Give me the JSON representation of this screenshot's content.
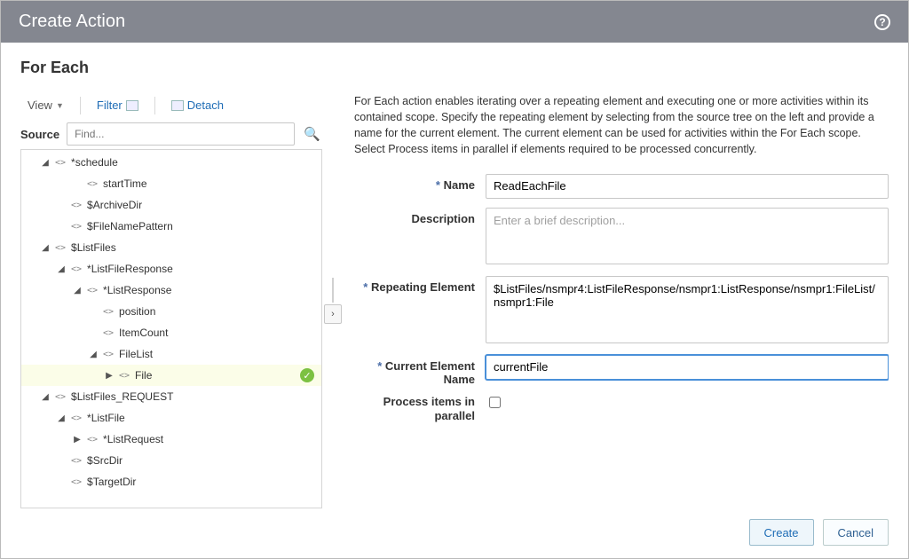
{
  "header": {
    "title": "Create Action"
  },
  "section_title": "For Each",
  "toolbar": {
    "view_label": "View",
    "filter_label": "Filter",
    "detach_label": "Detach"
  },
  "source": {
    "label": "Source",
    "find_placeholder": "Find..."
  },
  "tree": [
    {
      "indent": 0,
      "toggle": "▲",
      "kind": "tag",
      "star": true,
      "label": "schedule"
    },
    {
      "indent": 2,
      "toggle": "",
      "kind": "tag",
      "star": false,
      "label": "startTime"
    },
    {
      "indent": 1,
      "toggle": "",
      "kind": "var",
      "star": false,
      "label": "ArchiveDir"
    },
    {
      "indent": 1,
      "toggle": "",
      "kind": "var",
      "star": false,
      "label": "FileNamePattern"
    },
    {
      "indent": 0,
      "toggle": "▲",
      "kind": "var",
      "star": false,
      "label": "ListFiles"
    },
    {
      "indent": 1,
      "toggle": "▲",
      "kind": "tag",
      "star": true,
      "label": "ListFileResponse"
    },
    {
      "indent": 2,
      "toggle": "▲",
      "kind": "tag",
      "star": true,
      "label": "ListResponse"
    },
    {
      "indent": 3,
      "toggle": "",
      "kind": "tag",
      "star": false,
      "label": "position"
    },
    {
      "indent": 3,
      "toggle": "",
      "kind": "tag",
      "star": false,
      "label": "ItemCount"
    },
    {
      "indent": 3,
      "toggle": "▲",
      "kind": "tag",
      "star": false,
      "label": "FileList"
    },
    {
      "indent": 4,
      "toggle": "▶",
      "kind": "tag",
      "star": false,
      "label": "File",
      "selected": true,
      "check": true
    },
    {
      "indent": 0,
      "toggle": "▲",
      "kind": "var",
      "star": false,
      "label": "ListFiles_REQUEST"
    },
    {
      "indent": 1,
      "toggle": "▲",
      "kind": "tag",
      "star": true,
      "label": "ListFile"
    },
    {
      "indent": 2,
      "toggle": "▶",
      "kind": "tag",
      "star": true,
      "label": "ListRequest"
    },
    {
      "indent": 1,
      "toggle": "",
      "kind": "var",
      "star": false,
      "label": "SrcDir"
    },
    {
      "indent": 1,
      "toggle": "",
      "kind": "var",
      "star": false,
      "label": "TargetDir"
    }
  ],
  "description_text": "For Each action enables iterating over a repeating element and executing one or more activities within its contained scope. Specify the repeating element by selecting from the source tree on the left and provide a name for the current element. The current element can be used for activities within the For Each scope. Select Process items in parallel if elements required to be processed concurrently.",
  "form": {
    "name_label": "Name",
    "name_value": "ReadEachFile",
    "desc_label": "Description",
    "desc_placeholder": "Enter a brief description...",
    "desc_value": "",
    "repeating_label": "Repeating Element",
    "repeating_value": "$ListFiles/nsmpr4:ListFileResponse/nsmpr1:ListResponse/nsmpr1:FileList/nsmpr1:File",
    "current_label": "Current Element Name",
    "current_value": "currentFile",
    "parallel_label": "Process items in parallel",
    "parallel_checked": false
  },
  "footer": {
    "create_label": "Create",
    "cancel_label": "Cancel"
  }
}
